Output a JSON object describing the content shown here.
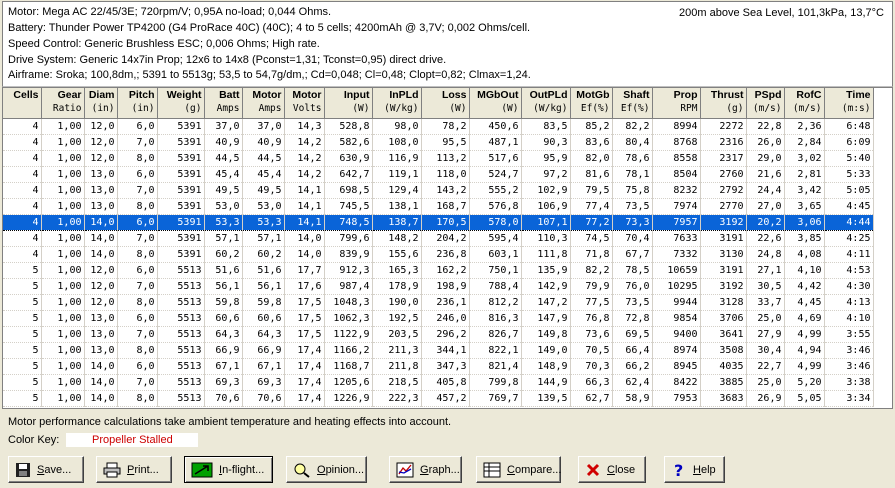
{
  "info": {
    "motor": "Motor: Mega AC 22/45/3E; 720rpm/V; 0,95A no-load; 0,044 Ohms.",
    "battery": "Battery: Thunder Power TP4200 (G4 ProRace 40C) (40C); 4 to 5 cells; 4200mAh @ 3,7V; 0,002 Ohms/cell.",
    "speed_control": "Speed Control: Generic Brushless ESC; 0,006 Ohms; High rate.",
    "drive_system": "Drive System: Generic 14x7in Prop; 12x6 to 14x8 (Pconst=1,31; Tconst=0,95) direct drive.",
    "airframe": "Airframe: Sroka; 100,8dm,; 5391 to 5513g; 53,5 to 54,7g/dm,; Cd=0,048; Cl=0,48; Clopt=0,82; Clmax=1,24.",
    "conditions": "200m above Sea Level, 101,3kPa, 13,7°C"
  },
  "table": {
    "columns": [
      {
        "title": "Cells",
        "unit": ""
      },
      {
        "title": "Gear",
        "unit": "Ratio"
      },
      {
        "title": "Diam",
        "unit": "(in)"
      },
      {
        "title": "Pitch",
        "unit": "(in)"
      },
      {
        "title": "Weight",
        "unit": "(g)"
      },
      {
        "title": "Batt",
        "unit": "Amps"
      },
      {
        "title": "Motor",
        "unit": "Amps"
      },
      {
        "title": "Motor",
        "unit": "Volts"
      },
      {
        "title": "Input",
        "unit": "(W)"
      },
      {
        "title": "InPLd",
        "unit": "(W/kg)"
      },
      {
        "title": "Loss",
        "unit": "(W)"
      },
      {
        "title": "MGbOut",
        "unit": "(W)"
      },
      {
        "title": "OutPLd",
        "unit": "(W/kg)"
      },
      {
        "title": "MotGb",
        "unit": "Ef(%)"
      },
      {
        "title": "Shaft",
        "unit": "Ef(%)"
      },
      {
        "title": "Prop",
        "unit": "RPM"
      },
      {
        "title": "Thrust",
        "unit": "(g)"
      },
      {
        "title": "PSpd",
        "unit": "(m/s)"
      },
      {
        "title": "RofC",
        "unit": "(m/s)"
      },
      {
        "title": "Time",
        "unit": "(m:s)"
      }
    ],
    "selected_row": 6,
    "rows": [
      [
        "4",
        "1,00",
        "12,0",
        "6,0",
        "5391",
        "37,0",
        "37,0",
        "14,3",
        "528,8",
        "98,0",
        "78,2",
        "450,6",
        "83,5",
        "85,2",
        "82,2",
        "8994",
        "2272",
        "22,8",
        "2,36",
        "6:48"
      ],
      [
        "4",
        "1,00",
        "12,0",
        "7,0",
        "5391",
        "40,9",
        "40,9",
        "14,2",
        "582,6",
        "108,0",
        "95,5",
        "487,1",
        "90,3",
        "83,6",
        "80,4",
        "8768",
        "2316",
        "26,0",
        "2,84",
        "6:09"
      ],
      [
        "4",
        "1,00",
        "12,0",
        "8,0",
        "5391",
        "44,5",
        "44,5",
        "14,2",
        "630,9",
        "116,9",
        "113,2",
        "517,6",
        "95,9",
        "82,0",
        "78,6",
        "8558",
        "2317",
        "29,0",
        "3,02",
        "5:40"
      ],
      [
        "4",
        "1,00",
        "13,0",
        "6,0",
        "5391",
        "45,4",
        "45,4",
        "14,2",
        "642,7",
        "119,1",
        "118,0",
        "524,7",
        "97,2",
        "81,6",
        "78,1",
        "8504",
        "2760",
        "21,6",
        "2,81",
        "5:33"
      ],
      [
        "4",
        "1,00",
        "13,0",
        "7,0",
        "5391",
        "49,5",
        "49,5",
        "14,1",
        "698,5",
        "129,4",
        "143,2",
        "555,2",
        "102,9",
        "79,5",
        "75,8",
        "8232",
        "2792",
        "24,4",
        "3,42",
        "5:05"
      ],
      [
        "4",
        "1,00",
        "13,0",
        "8,0",
        "5391",
        "53,0",
        "53,0",
        "14,1",
        "745,5",
        "138,1",
        "168,7",
        "576,8",
        "106,9",
        "77,4",
        "73,5",
        "7974",
        "2770",
        "27,0",
        "3,65",
        "4:45"
      ],
      [
        "4",
        "1,00",
        "14,0",
        "6,0",
        "5391",
        "53,3",
        "53,3",
        "14,1",
        "748,5",
        "138,7",
        "170,5",
        "578,0",
        "107,1",
        "77,2",
        "73,3",
        "7957",
        "3192",
        "20,2",
        "3,06",
        "4:44"
      ],
      [
        "4",
        "1,00",
        "14,0",
        "7,0",
        "5391",
        "57,1",
        "57,1",
        "14,0",
        "799,6",
        "148,2",
        "204,2",
        "595,4",
        "110,3",
        "74,5",
        "70,4",
        "7633",
        "3191",
        "22,6",
        "3,85",
        "4:25"
      ],
      [
        "4",
        "1,00",
        "14,0",
        "8,0",
        "5391",
        "60,2",
        "60,2",
        "14,0",
        "839,9",
        "155,6",
        "236,8",
        "603,1",
        "111,8",
        "71,8",
        "67,7",
        "7332",
        "3130",
        "24,8",
        "4,08",
        "4:11"
      ],
      [
        "5",
        "1,00",
        "12,0",
        "6,0",
        "5513",
        "51,6",
        "51,6",
        "17,7",
        "912,3",
        "165,3",
        "162,2",
        "750,1",
        "135,9",
        "82,2",
        "78,5",
        "10659",
        "3191",
        "27,1",
        "4,10",
        "4:53"
      ],
      [
        "5",
        "1,00",
        "12,0",
        "7,0",
        "5513",
        "56,1",
        "56,1",
        "17,6",
        "987,4",
        "178,9",
        "198,9",
        "788,4",
        "142,9",
        "79,9",
        "76,0",
        "10295",
        "3192",
        "30,5",
        "4,42",
        "4:30"
      ],
      [
        "5",
        "1,00",
        "12,0",
        "8,0",
        "5513",
        "59,8",
        "59,8",
        "17,5",
        "1048,3",
        "190,0",
        "236,1",
        "812,2",
        "147,2",
        "77,5",
        "73,5",
        "9944",
        "3128",
        "33,7",
        "4,45",
        "4:13"
      ],
      [
        "5",
        "1,00",
        "13,0",
        "6,0",
        "5513",
        "60,6",
        "60,6",
        "17,5",
        "1062,3",
        "192,5",
        "246,0",
        "816,3",
        "147,9",
        "76,8",
        "72,8",
        "9854",
        "3706",
        "25,0",
        "4,69",
        "4:10"
      ],
      [
        "5",
        "1,00",
        "13,0",
        "7,0",
        "5513",
        "64,3",
        "64,3",
        "17,5",
        "1122,9",
        "203,5",
        "296,2",
        "826,7",
        "149,8",
        "73,6",
        "69,5",
        "9400",
        "3641",
        "27,9",
        "4,99",
        "3:55"
      ],
      [
        "5",
        "1,00",
        "13,0",
        "8,0",
        "5513",
        "66,9",
        "66,9",
        "17,4",
        "1166,2",
        "211,3",
        "344,1",
        "822,1",
        "149,0",
        "70,5",
        "66,4",
        "8974",
        "3508",
        "30,4",
        "4,94",
        "3:46"
      ],
      [
        "5",
        "1,00",
        "14,0",
        "6,0",
        "5513",
        "67,1",
        "67,1",
        "17,4",
        "1168,7",
        "211,8",
        "347,3",
        "821,4",
        "148,9",
        "70,3",
        "66,2",
        "8945",
        "4035",
        "22,7",
        "4,99",
        "3:46"
      ],
      [
        "5",
        "1,00",
        "14,0",
        "7,0",
        "5513",
        "69,3",
        "69,3",
        "17,4",
        "1205,6",
        "218,5",
        "405,8",
        "799,8",
        "144,9",
        "66,3",
        "62,4",
        "8422",
        "3885",
        "25,0",
        "5,20",
        "3:38"
      ],
      [
        "5",
        "1,00",
        "14,0",
        "8,0",
        "5513",
        "70,6",
        "70,6",
        "17,4",
        "1226,9",
        "222,3",
        "457,2",
        "769,7",
        "139,5",
        "62,7",
        "58,9",
        "7953",
        "3683",
        "26,9",
        "5,05",
        "3:34"
      ]
    ]
  },
  "note": "Motor performance calculations take ambient temperature and heating effects into account.",
  "color_key": {
    "label": "Color Key:",
    "item": "Propeller Stalled",
    "item_color": "#cc0000"
  },
  "buttons": {
    "save": "Save...",
    "print": "Print...",
    "inflight": "In-flight...",
    "opinion": "Opinion...",
    "graph": "Graph...",
    "compare": "Compare...",
    "close": "Close",
    "help": "Help"
  }
}
